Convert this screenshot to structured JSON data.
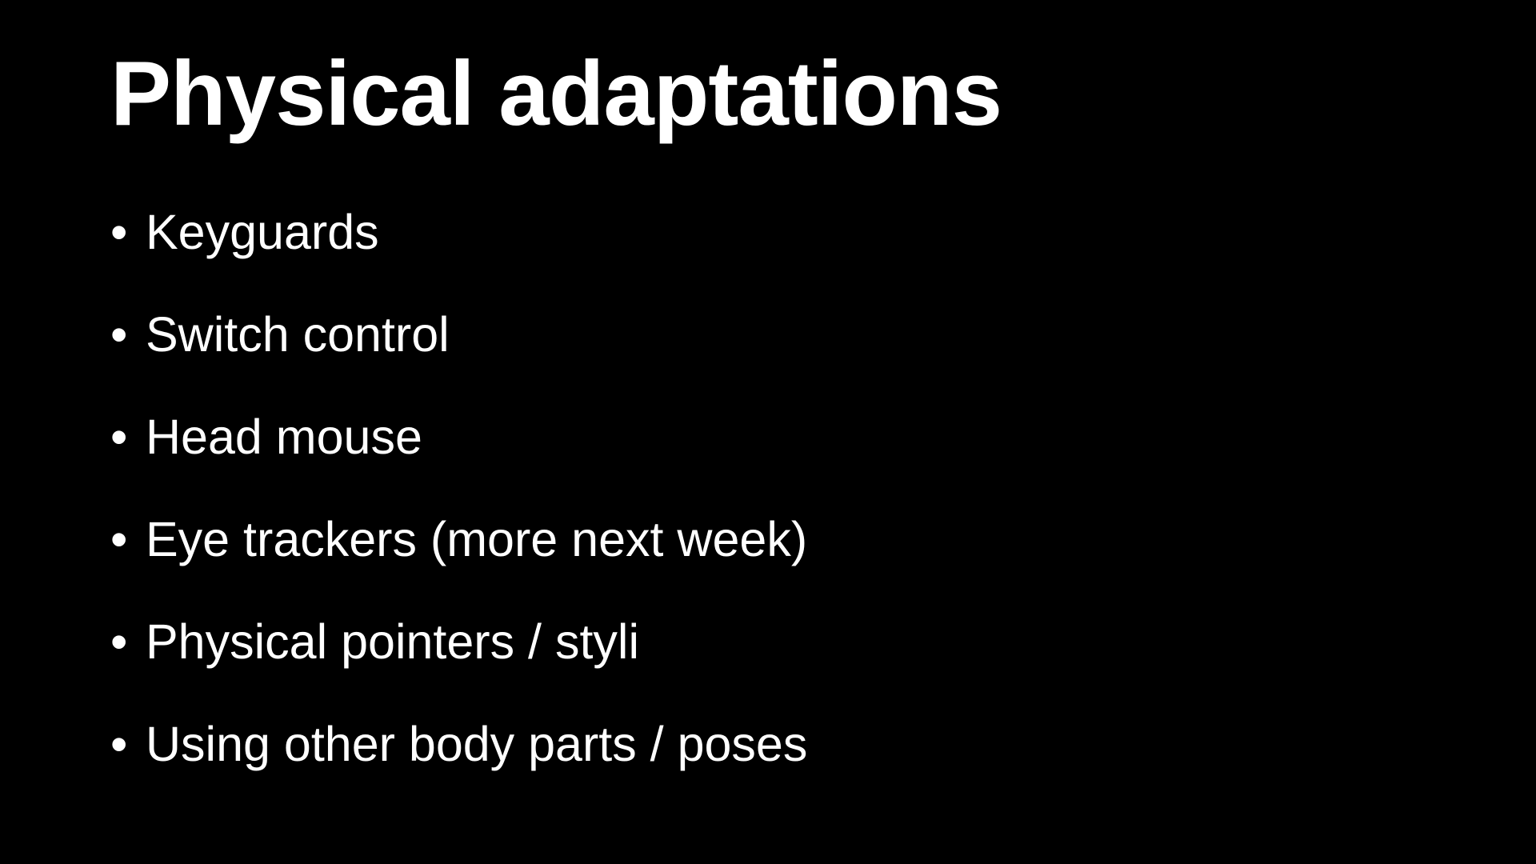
{
  "slide": {
    "title": "Physical adaptations",
    "bullet_glyph": "•",
    "bullets": [
      "Keyguards",
      "Switch control",
      "Head mouse",
      "Eye trackers (more next week)",
      "Physical pointers / styli",
      "Using other body parts / poses"
    ]
  },
  "colors": {
    "background": "#000000",
    "text": "#ffffff"
  }
}
